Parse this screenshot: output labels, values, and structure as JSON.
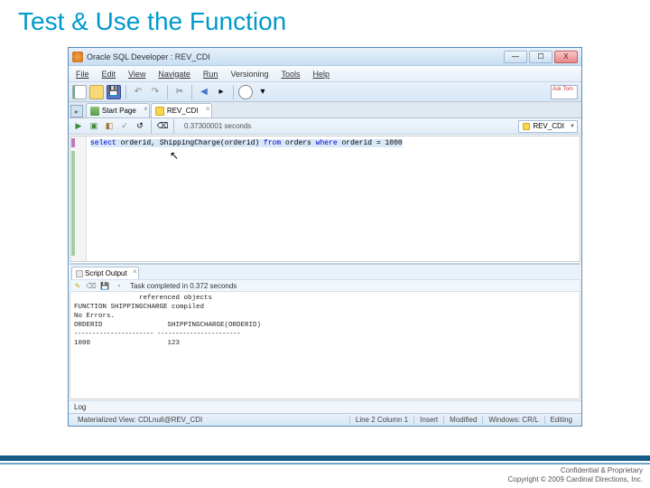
{
  "slide": {
    "title": "Test & Use the Function"
  },
  "window": {
    "title": "Oracle SQL Developer : REV_CDI",
    "controls": {
      "min": "—",
      "max": "☐",
      "close": "X"
    }
  },
  "menu": {
    "file": "File",
    "edit": "Edit",
    "view": "View",
    "navigate": "Navigate",
    "run": "Run",
    "versioning": "Versioning",
    "tools": "Tools",
    "help": "Help"
  },
  "toolbar": {
    "ask": "Ask\nTom"
  },
  "tabs": {
    "panel_toggle": "▸",
    "start": "Start Page",
    "worksheet": "REV_CDI"
  },
  "sql_toolbar": {
    "status": "0.37300001 seconds",
    "connection": "REV_CDI"
  },
  "editor": {
    "line1_kw1": "select",
    "line1_col1": " orderid, ShippingCharge(orderid) ",
    "line1_kw2": "from",
    "line1_col2": " orders ",
    "line1_kw3": "where",
    "line1_col3": " orderid = 1000"
  },
  "output": {
    "tab_label": "Script Output",
    "status": "Task completed in 0.372 seconds",
    "body_line1": "                referenced objects",
    "body_line2": "FUNCTION SHIPPINGCHARGE compiled",
    "body_line3": "No Errors.",
    "body_line4": "ORDERID                SHIPPINGCHARGE(ORDERID)",
    "body_line5": "---------------------- -----------------------",
    "body_line6": "1000                   123"
  },
  "log": {
    "label": "Log"
  },
  "statusbar": {
    "left": "Materialized View: CDLnull@REV_CDI",
    "cursor": "Line 2 Column 1",
    "mode": "Insert",
    "modified": "Modified",
    "conn": "Windows: CR/L",
    "editing": "Editing"
  },
  "footer": {
    "line1": "Confidential & Proprietary",
    "line2": "Copyright © 2009 Cardinal Directions, Inc."
  }
}
